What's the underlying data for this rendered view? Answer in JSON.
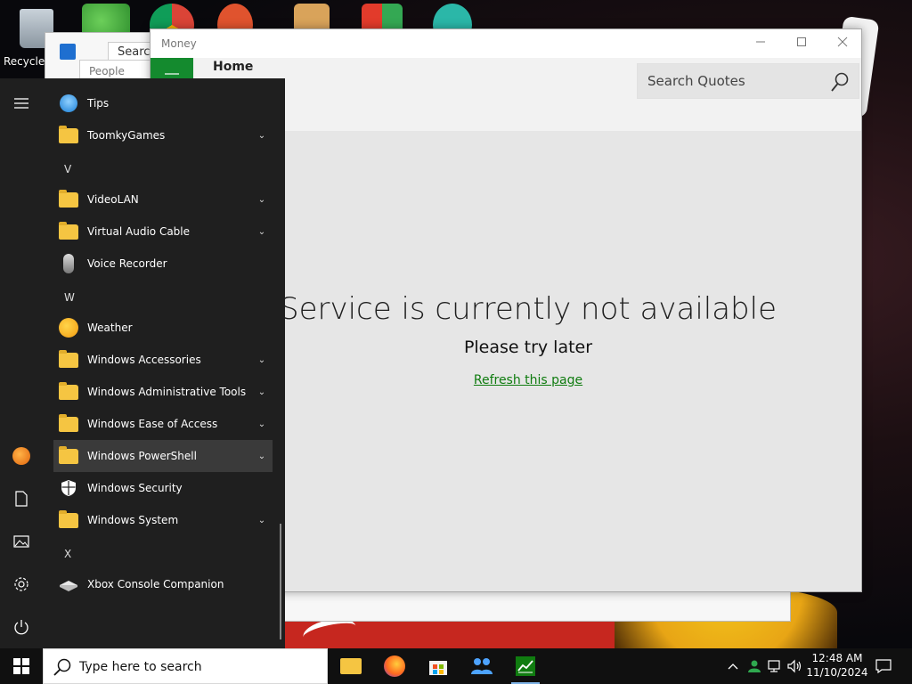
{
  "desktop": {
    "recycle_label": "Recycle"
  },
  "back_window": {
    "search_label": "Search",
    "people_label": "People"
  },
  "money_window": {
    "title": "Money",
    "header_title": "Home",
    "search_placeholder": "Search Quotes",
    "error_title": "Service is currently not available",
    "error_subtitle": "Please try later",
    "refresh_link": "Refresh this page",
    "accent_color": "#107c10"
  },
  "start_menu": {
    "apps": [
      {
        "type": "app",
        "label": "Tips",
        "icon": "lightbulb-icon"
      },
      {
        "type": "folder",
        "label": "ToomkyGames",
        "icon": "folder-icon"
      },
      {
        "type": "letter",
        "label": "V"
      },
      {
        "type": "folder",
        "label": "VideoLAN",
        "icon": "folder-icon"
      },
      {
        "type": "folder",
        "label": "Virtual Audio Cable",
        "icon": "folder-icon"
      },
      {
        "type": "app",
        "label": "Voice Recorder",
        "icon": "microphone-icon"
      },
      {
        "type": "letter",
        "label": "W"
      },
      {
        "type": "app",
        "label": "Weather",
        "icon": "weather-icon"
      },
      {
        "type": "folder",
        "label": "Windows Accessories",
        "icon": "folder-icon"
      },
      {
        "type": "folder",
        "label": "Windows Administrative Tools",
        "icon": "folder-icon"
      },
      {
        "type": "folder",
        "label": "Windows Ease of Access",
        "icon": "folder-icon"
      },
      {
        "type": "folder",
        "label": "Windows PowerShell",
        "icon": "folder-icon"
      },
      {
        "type": "app",
        "label": "Windows Security",
        "icon": "shield-icon"
      },
      {
        "type": "folder",
        "label": "Windows System",
        "icon": "folder-icon"
      },
      {
        "type": "letter",
        "label": "X"
      },
      {
        "type": "app",
        "label": "Xbox Console Companion",
        "icon": "xbox-icon"
      }
    ],
    "rail_icons": [
      "hamburger-icon",
      "user-avatar-icon",
      "documents-icon",
      "pictures-icon",
      "settings-icon",
      "power-icon"
    ]
  },
  "taskbar": {
    "search_placeholder": "Type here to search",
    "time": "12:48 AM",
    "date": "11/10/2024",
    "apps": [
      "file-explorer-icon",
      "firefox-icon",
      "store-icon",
      "people-icon",
      "money-icon"
    ]
  }
}
